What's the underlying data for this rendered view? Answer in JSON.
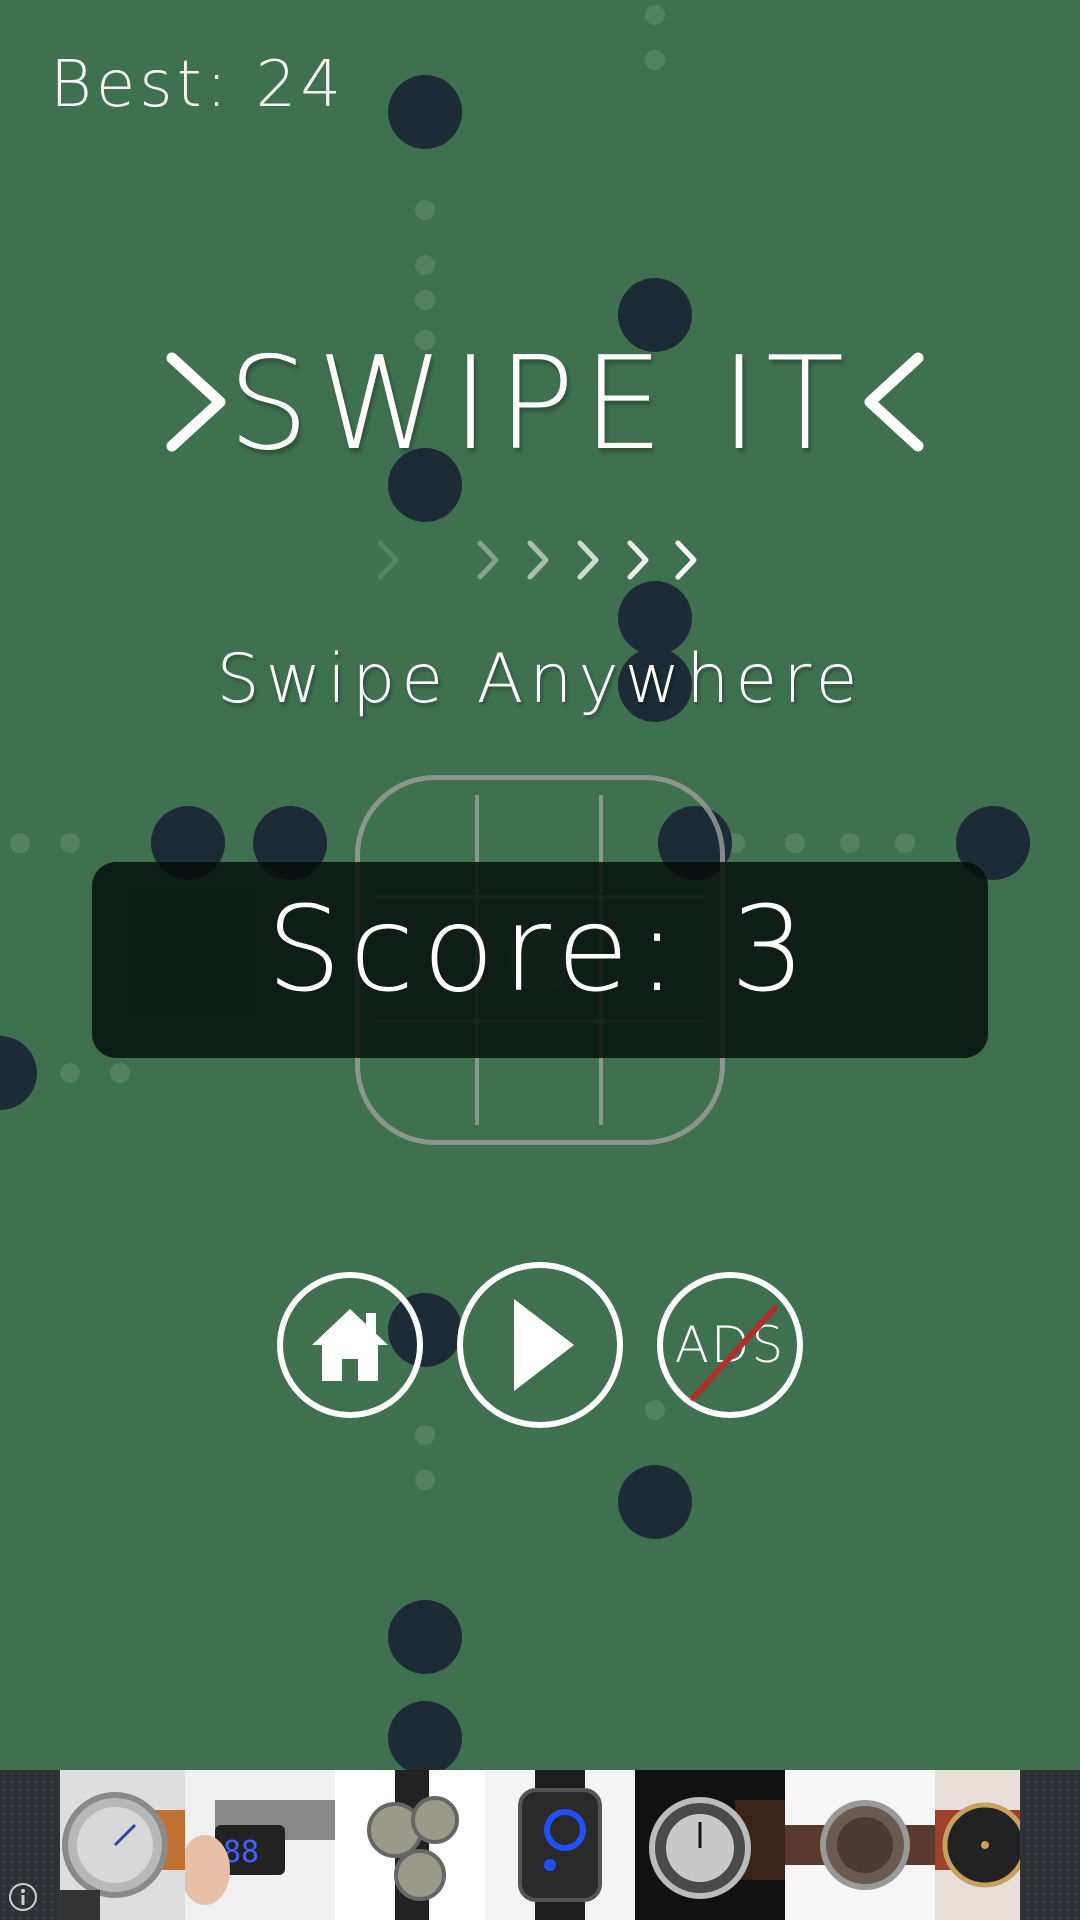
{
  "hud": {
    "best": "Best: 24"
  },
  "title": {
    "text": "SWIPE IT"
  },
  "hint": {
    "arrows_icon": "chevron-trail-icon",
    "text": "Swipe Anywhere"
  },
  "score": {
    "text": "Score: 3"
  },
  "buttons": {
    "home_icon": "home-icon",
    "play_icon": "play-icon",
    "ads_label": "ADS"
  },
  "ad_banner": {
    "info_icon": "info-icon",
    "items": [
      "watch-thumbnail",
      "watch-thumbnail",
      "watch-thumbnail",
      "watch-thumbnail",
      "watch-thumbnail",
      "watch-thumbnail",
      "watch-thumbnail"
    ]
  },
  "colors": {
    "background": "#3f7150",
    "dot": "#1c2b35",
    "panel": "#0b140f",
    "text": "#ffffff",
    "strike": "#b0302b"
  }
}
